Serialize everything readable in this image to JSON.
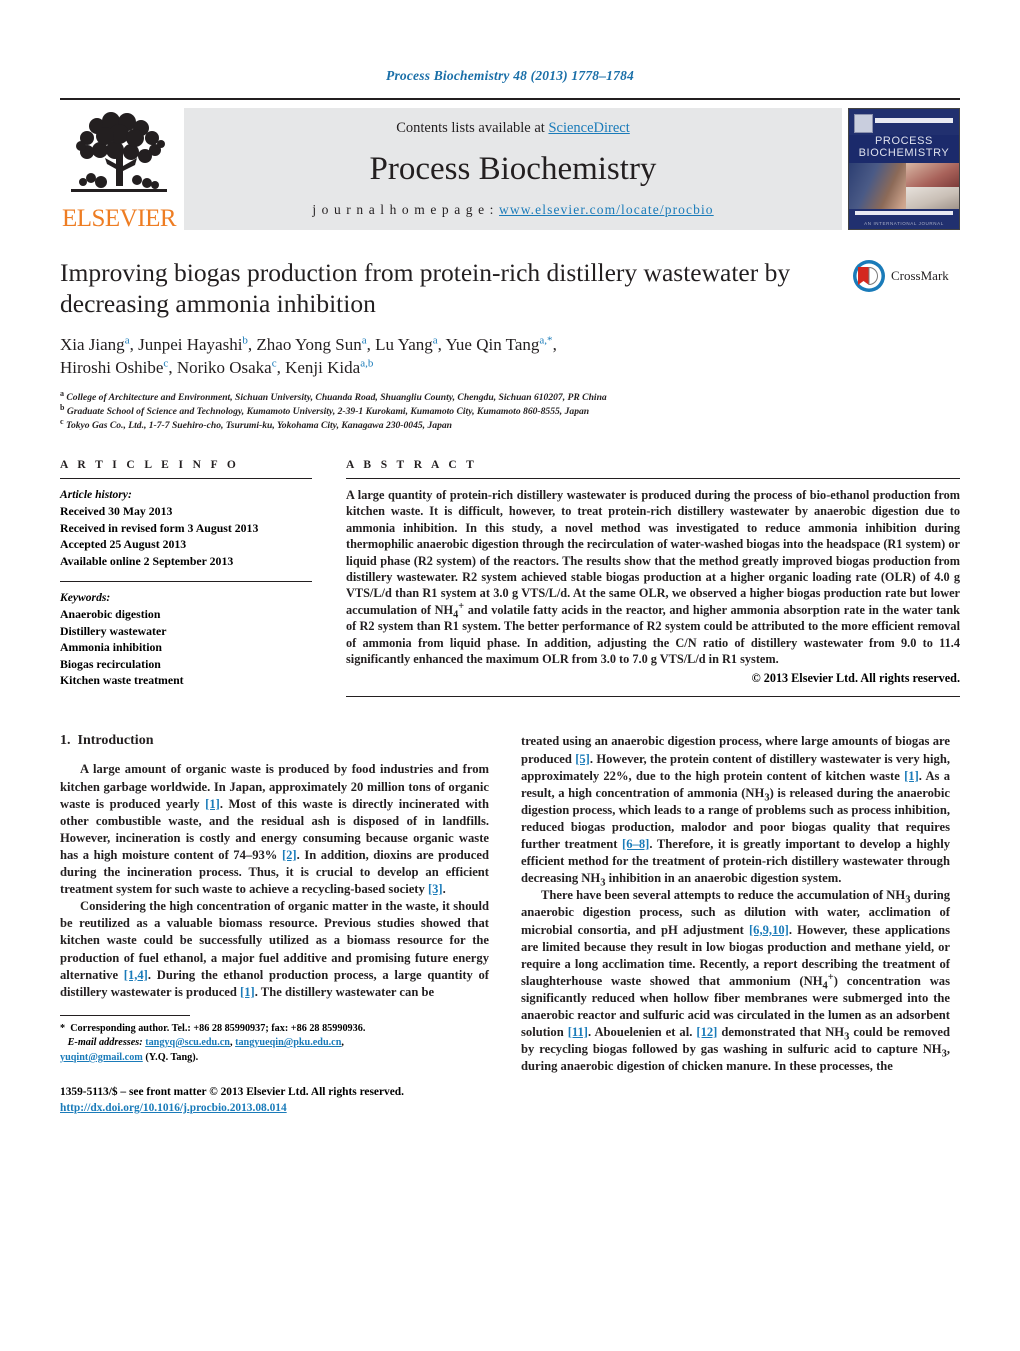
{
  "running_head": "Process Biochemistry 48 (2013) 1778–1784",
  "banner": {
    "contents_prefix": "Contents lists available at ",
    "sciencedirect": "ScienceDirect",
    "journal_name": "Process Biochemistry",
    "homepage_prefix": "j o u r n a l   h o m e p a g e :   ",
    "homepage_url": "www.elsevier.com/locate/procbio",
    "publisher_wordmark": "ELSEVIER",
    "cover_title_line1": "PROCESS",
    "cover_title_line2": "BIOCHEMISTRY",
    "cover_footer": "AN INTERNATIONAL JOURNAL"
  },
  "article": {
    "title": "Improving biogas production from protein-rich distillery wastewater by decreasing ammonia inhibition",
    "crossmark_label": "CrossMark",
    "authors_line1": "Xia Jiang<sup>a</sup>, Junpei Hayashi<sup>b</sup>, Zhao Yong Sun<sup>a</sup>, Lu Yang<sup>a</sup>, Yue Qin Tang<sup>a,*</sup>,",
    "authors_line2": "Hiroshi Oshibe<sup>c</sup>, Noriko Osaka<sup>c</sup>, Kenji Kida<sup>a,b</sup>",
    "affiliations": [
      {
        "marker": "a",
        "text": "College of Architecture and Environment, Sichuan University, Chuanda Road, Shuangliu County, Chengdu, Sichuan 610207, PR China"
      },
      {
        "marker": "b",
        "text": "Graduate School of Science and Technology, Kumamoto University, 2-39-1 Kurokami, Kumamoto City, Kumamoto 860-8555, Japan"
      },
      {
        "marker": "c",
        "text": "Tokyo Gas Co., Ltd., 1-7-7 Suehiro-cho, Tsurumi-ku, Yokohama City, Kanagawa 230-0045, Japan"
      }
    ]
  },
  "article_info": {
    "heading": "A R T I C L E    I N F O",
    "history_label": "Article history:",
    "history": [
      "Received 30 May 2013",
      "Received in revised form 3 August 2013",
      "Accepted 25 August 2013",
      "Available online 2 September 2013"
    ],
    "keywords_label": "Keywords:",
    "keywords": [
      "Anaerobic digestion",
      "Distillery wastewater",
      "Ammonia inhibition",
      "Biogas recirculation",
      "Kitchen waste treatment"
    ]
  },
  "abstract": {
    "heading": "A B S T R A C T",
    "text": "A large quantity of protein-rich distillery wastewater is produced during the process of bio-ethanol production from kitchen waste. It is difficult, however, to treat protein-rich distillery wastewater by anaerobic digestion due to ammonia inhibition. In this study, a novel method was investigated to reduce ammonia inhibition during thermophilic anaerobic digestion through the recirculation of water-washed biogas into the headspace (R1 system) or liquid phase (R2 system) of the reactors. The results show that the method greatly improved biogas production from distillery wastewater. R2 system achieved stable biogas production at a higher organic loading rate (OLR) of 4.0 g VTS/L/d than R1 system at 3.0 g VTS/L/d. At the same OLR, we observed a higher biogas production rate but lower accumulation of NH4+ and volatile fatty acids in the reactor, and higher ammonia absorption rate in the water tank of R2 system than R1 system. The better performance of R2 system could be attributed to the more efficient removal of ammonia from liquid phase. In addition, adjusting the C/N ratio of distillery wastewater from 9.0 to 11.4 significantly enhanced the maximum OLR from 3.0 to 7.0 g VTS/L/d in R1 system.",
    "copyright": "© 2013 Elsevier Ltd. All rights reserved."
  },
  "introduction": {
    "section_number": "1.",
    "section_title": "Introduction",
    "paragraphs_left": [
      "A large amount of organic waste is produced by food industries and from kitchen garbage worldwide. In Japan, approximately 20 million tons of organic waste is produced yearly [1]. Most of this waste is directly incinerated with other combustible waste, and the residual ash is disposed of in landfills. However, incineration is costly and energy consuming because organic waste has a high moisture content of 74–93% [2]. In addition, dioxins are produced during the incineration process. Thus, it is crucial to develop an efficient treatment system for such waste to achieve a recycling-based society [3].",
      "Considering the high concentration of organic matter in the waste, it should be reutilized as a valuable biomass resource. Previous studies showed that kitchen waste could be successfully utilized as a biomass resource for the production of fuel ethanol, a major fuel additive and promising future energy alternative [1,4]. During the ethanol production process, a large quantity of distillery wastewater is produced [1]. The distillery wastewater can be"
    ],
    "paragraphs_right": [
      "treated using an anaerobic digestion process, where large amounts of biogas are produced [5]. However, the protein content of distillery wastewater is very high, approximately 22%, due to the high protein content of kitchen waste [1]. As a result, a high concentration of ammonia (NH3) is released during the anaerobic digestion process, which leads to a range of problems such as process inhibition, reduced biogas production, malodor and poor biogas quality that requires further treatment [6–8]. Therefore, it is greatly important to develop a highly efficient method for the treatment of protein-rich distillery wastewater through decreasing NH3 inhibition in an anaerobic digestion system.",
      "There have been several attempts to reduce the accumulation of NH3 during anaerobic digestion process, such as dilution with water, acclimation of microbial consortia, and pH adjustment [6,9,10]. However, these applications are limited because they result in low biogas production and methane yield, or require a long acclimation time. Recently, a report describing the treatment of slaughterhouse waste showed that ammonium (NH4+) concentration was significantly reduced when hollow fiber membranes were submerged into the anaerobic reactor and sulfuric acid was circulated in the lumen as an adsorbent solution [11]. Abouelenien et al. [12] demonstrated that NH3 could be removed by recycling biogas followed by gas washing in sulfuric acid to capture NH3, during anaerobic digestion of chicken manure. In these processes, the"
    ]
  },
  "footnote": {
    "star": "*",
    "corresponding": "Corresponding author. Tel.: +86 28 85990937; fax: +86 28 85990936.",
    "email_label": "E-mail addresses:",
    "emails": "tangyq@scu.edu.cn, tangyueqin@pku.edu.cn, yuqint@gmail.com",
    "email_suffix": " (Y.Q. Tang)."
  },
  "footer": {
    "issn_line": "1359-5113/$ – see front matter © 2013 Elsevier Ltd. All rights reserved.",
    "doi": "http://dx.doi.org/10.1016/j.procbio.2013.08.014"
  },
  "colors": {
    "link_blue": "#1a7bb9",
    "running_head_blue": "#1a6fa8",
    "elsevier_orange": "#ee7d23",
    "banner_grey": "#e6e7e8",
    "ink": "#231f20"
  }
}
